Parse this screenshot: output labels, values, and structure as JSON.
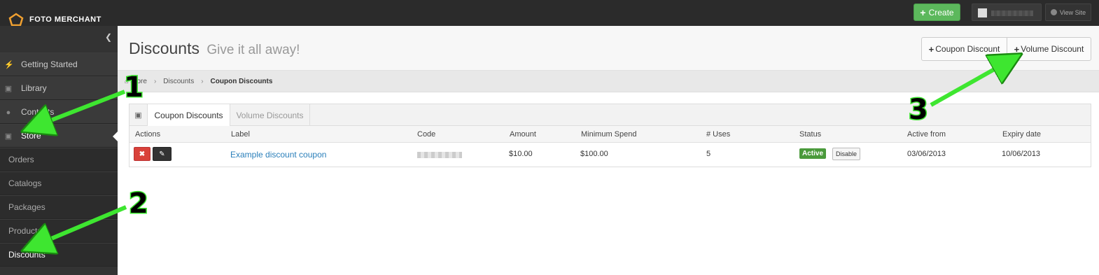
{
  "brand": {
    "name": "FOTO MERCHANT"
  },
  "topbar": {
    "create_label": "Create",
    "view_site_label": "View Site"
  },
  "sidebar": {
    "items": [
      {
        "label": "Getting Started",
        "icon": "bolt-icon"
      },
      {
        "label": "Library",
        "icon": "image-icon"
      },
      {
        "label": "Contacts",
        "icon": "user-icon"
      },
      {
        "label": "Store",
        "icon": "cart-icon"
      },
      {
        "label": "Orders"
      },
      {
        "label": "Catalogs"
      },
      {
        "label": "Packages"
      },
      {
        "label": "Products"
      },
      {
        "label": "Discounts"
      }
    ]
  },
  "header": {
    "title": "Discounts",
    "subtitle": "Give it all away!",
    "coupon_btn": "Coupon Discount",
    "volume_btn": "Volume Discount"
  },
  "breadcrumb": [
    "Store",
    "Discounts",
    "Coupon Discounts"
  ],
  "tabs": [
    "Coupon Discounts",
    "Volume Discounts"
  ],
  "table": {
    "columns": [
      "Actions",
      "Label",
      "Code",
      "Amount",
      "Minimum Spend",
      "# Uses",
      "Status",
      "Active from",
      "Expiry date"
    ],
    "rows": [
      {
        "label": "Example discount coupon",
        "amount": "$10.00",
        "min_spend": "$100.00",
        "uses": "5",
        "status": "Active",
        "action": "Disable",
        "active_from": "03/06/2013",
        "expiry": "10/06/2013"
      }
    ]
  },
  "annotations": [
    "1",
    "2",
    "3"
  ],
  "colors": {
    "accent_green": "#5cb85c",
    "status_active": "#4a9a3b",
    "link": "#2a7fba",
    "delete_red": "#d9413a",
    "arrow_green": "#3ee630",
    "logo_orange": "#f0a030"
  }
}
